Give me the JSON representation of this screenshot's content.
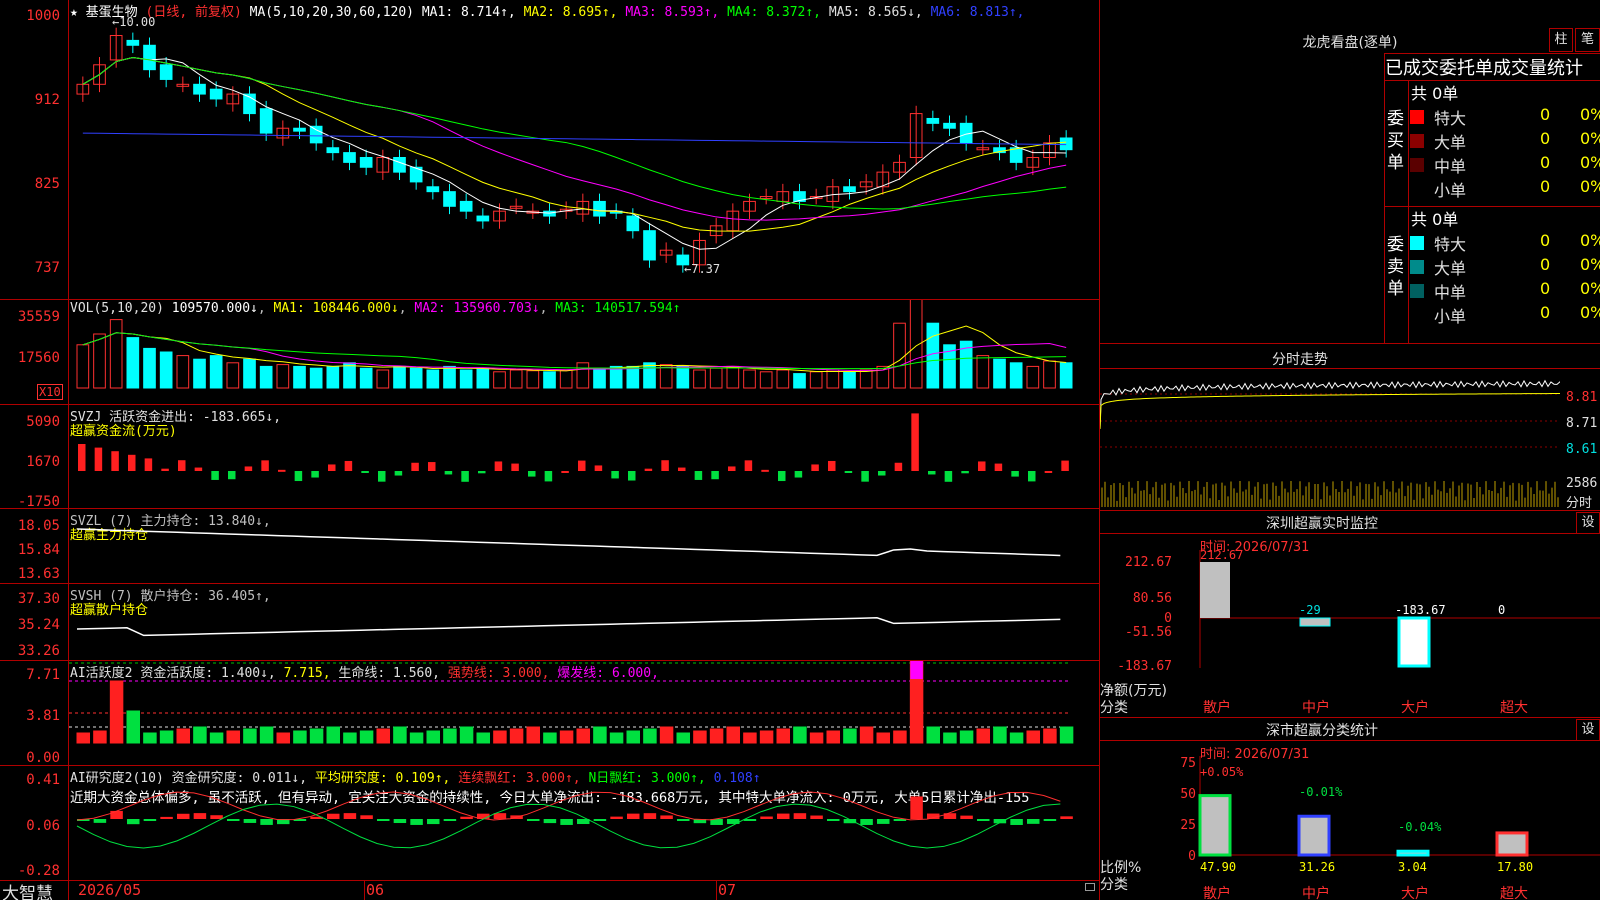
{
  "main": {
    "star": "★",
    "stock_name": "基蛋生物",
    "period": "(日线, 前复权)",
    "ma_prefix": "MA(5,10,20,30,60,120)",
    "ma": [
      {
        "label": "MA1: 8.714↑",
        "color": "#ffffff"
      },
      {
        "label": "MA2: 8.695↑",
        "color": "#ffff00"
      },
      {
        "label": "MA3: 8.593↑",
        "color": "#ff00ff"
      },
      {
        "label": "MA4: 8.372↑",
        "color": "#00ff00"
      },
      {
        "label": "MA5: 8.565↓",
        "color": "#e0e0e0"
      },
      {
        "label": "MA6: 8.813↑",
        "color": "#3040ff"
      }
    ],
    "price_ticks": [
      "1000",
      "912",
      "825",
      "737"
    ],
    "high_mark": "←10.00",
    "low_mark": "←7.37"
  },
  "vol": {
    "header": "VOL(5,10,20)",
    "value": "109570.000↓",
    "ma1": "MA1: 108446.000↓",
    "ma2": "MA2: 135960.703↓",
    "ma3": "MA3: 140517.594↑",
    "ticks": [
      "35559",
      "17560"
    ],
    "unit": "X10"
  },
  "svzj": {
    "header": "SVZJ  活跃资金进出: -183.665↓,",
    "sub": "超赢资金流(万元)",
    "ticks": [
      "5090",
      "1670",
      "-1750"
    ]
  },
  "svzl": {
    "header": "SVZL (7) 主力持仓: 13.840↓,",
    "sub": "超赢主力持仓",
    "ticks": [
      "18.05",
      "15.84",
      "13.63"
    ]
  },
  "svsh": {
    "header": "SVSH (7) 散户持仓: 36.405↑,",
    "sub": "超赢散户持仓",
    "ticks": [
      "37.30",
      "35.24",
      "33.26"
    ]
  },
  "ai1": {
    "name": "AI活跃度2",
    "v1": "资金活跃度: 1.400↓,",
    "v2": "7.715,",
    "v3": "生命线: 1.560,",
    "v4": "强势线: 3.000,",
    "v5": "爆发线: 6.000,",
    "ticks": [
      "7.71",
      "3.81",
      "0.00"
    ]
  },
  "ai2": {
    "name": "AI研究度2(10)",
    "v1": "资金研究度: 0.011↓,",
    "v2": "平均研究度: 0.109↑,",
    "v3": "连续飘红: 3.000↑,",
    "v4": "N日飘红: 3.000↑,",
    "v5": "0.108↑",
    "comment": "近期大资金总体偏多, 虽不活跃, 但有异动, 宜关注大资金的持续性, 今日大单净流出: -183.668万元, 其中特大单净流入: 0万元, 大单5日累计净出-155",
    "ticks": [
      "0.41",
      "0.06",
      "-0.28"
    ]
  },
  "bottom": {
    "brand": "大智慧",
    "dates": [
      "2026/05",
      "06",
      "07"
    ]
  },
  "right": {
    "dragon_title": "龙虎看盘(逐单)",
    "btn_zhu": "柱",
    "btn_bi": "笔",
    "stats_title": "已成交委托单成交量统计",
    "buy_label": "委买单",
    "sell_label": "委卖单",
    "buy_total": "共 0单",
    "sell_total": "共 0单",
    "buy_rows": [
      {
        "name": "特大",
        "qty": "0",
        "pct": "0%",
        "color": "#ff0000"
      },
      {
        "name": "大单",
        "qty": "0",
        "pct": "0%",
        "color": "#8b0000"
      },
      {
        "name": "中单",
        "qty": "0",
        "pct": "0%",
        "color": "#5a0000"
      },
      {
        "name": "小单",
        "qty": "0",
        "pct": "0%",
        "color": "#000000"
      }
    ],
    "sell_rows": [
      {
        "name": "特大",
        "qty": "0",
        "pct": "0%",
        "color": "#00ffff"
      },
      {
        "name": "大单",
        "qty": "0",
        "pct": "0%",
        "color": "#008b8b"
      },
      {
        "name": "中单",
        "qty": "0",
        "pct": "0%",
        "color": "#006060"
      },
      {
        "name": "小单",
        "qty": "0",
        "pct": "0%",
        "color": "#000000"
      }
    ],
    "intraday_title": "分时走势",
    "intraday_ticks": [
      "8.81",
      "8.71",
      "8.61"
    ],
    "intraday_vol": "2586",
    "intraday_vol_unit": "分时",
    "monitor_title": "深圳超赢实时监控",
    "btn_set": "设",
    "monitor_time": "时间: 2026/07/31",
    "monitor_ticks": [
      "212.67",
      "80.56",
      "0",
      "-51.56",
      "-183.67"
    ],
    "monitor_ylabel": "净额(万元)",
    "monitor_xlabel": "分类",
    "monitor_values": [
      "212.67",
      "-29",
      "-183.67",
      "0"
    ],
    "categories": [
      "散户",
      "中户",
      "大户",
      "超大"
    ],
    "class_title": "深市超赢分类统计",
    "class_time": "时间: 2026/07/31",
    "class_ticks": [
      "75",
      "50",
      "25",
      "0"
    ],
    "class_ylabel": "比例%",
    "class_xlabel": "分类",
    "class_changes": [
      "+0.05%",
      "-0.01%",
      "-0.04%"
    ],
    "class_values": [
      "47.90",
      "31.26",
      "3.04",
      "17.80"
    ]
  }
}
